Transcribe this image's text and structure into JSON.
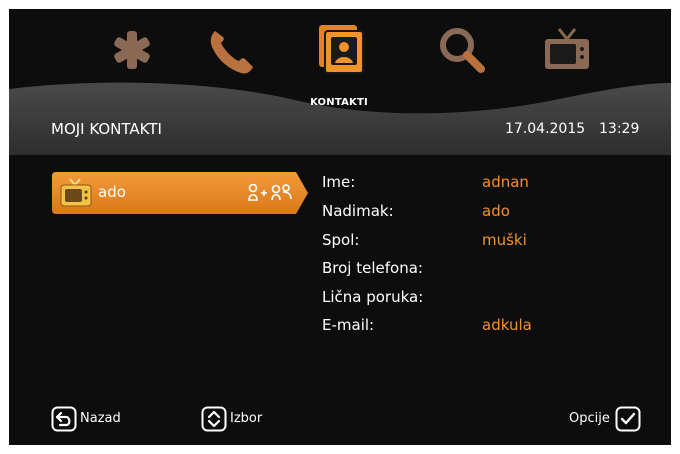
{
  "nav": {
    "items": [
      {
        "icon": "asterisk-icon"
      },
      {
        "icon": "phone-icon"
      },
      {
        "icon": "contacts-icon",
        "active": true
      },
      {
        "icon": "search-icon"
      },
      {
        "icon": "tv-icon"
      }
    ],
    "active_label": "KONTAKTI"
  },
  "header": {
    "title": "MOJI KONTAKTI",
    "date": "17.04.2015",
    "time": "13:29"
  },
  "contacts": [
    {
      "name": "ado",
      "avatar": "tv-avatar-icon",
      "status_icons": [
        "add-contact-icon",
        "group-icon"
      ]
    }
  ],
  "details": {
    "rows": [
      {
        "label": "Ime:",
        "value": "adnan"
      },
      {
        "label": "Nadimak:",
        "value": "ado"
      },
      {
        "label": "Spol:",
        "value": "muški"
      },
      {
        "label": "Broj telefona:",
        "value": ""
      },
      {
        "label": "Lična poruka:",
        "value": ""
      },
      {
        "label": "E-mail:",
        "value": "adkula"
      }
    ]
  },
  "footer": {
    "back_label": "Nazad",
    "select_label": "Izbor",
    "options_label": "Opcije"
  },
  "colors": {
    "accent": "#f0932f",
    "background": "#0d0d0d",
    "header_band": "#3a3a3a"
  }
}
